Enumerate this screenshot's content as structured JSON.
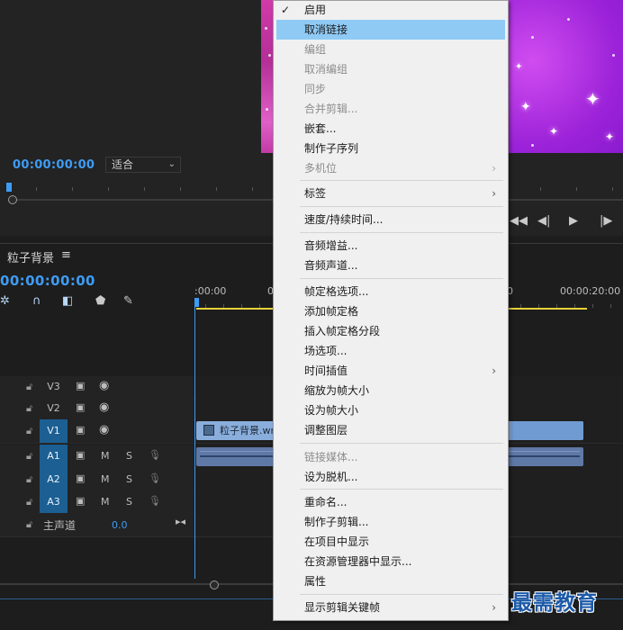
{
  "monitor": {
    "timecode": "00:00:00:00",
    "fit_label": "适合"
  },
  "transport": [
    "◀◀",
    "◀|",
    "▶",
    "|▶"
  ],
  "timeline": {
    "sequence_name": "粒子背景",
    "menu_glyph": "≡",
    "timecode": "00:00:00:00",
    "ruler": {
      "start": ":00:00",
      "zero": "0",
      "mid": "0",
      "end": "00:00:20:00"
    },
    "tracks": {
      "v3": "V3",
      "v2": "V2",
      "v1": "V1",
      "a1": "A1",
      "a2": "A2",
      "a3": "A3",
      "m": "M",
      "s": "S"
    },
    "master": {
      "label": "主声道",
      "value": "0.0"
    },
    "clip_v1_label": "粒子背景.wm"
  },
  "context_menu": {
    "items": [
      {
        "label": "启用",
        "checked": true
      },
      {
        "label": "取消链接",
        "hover": true
      },
      {
        "label": "编组",
        "disabled": true
      },
      {
        "label": "取消编组",
        "disabled": true
      },
      {
        "label": "同步",
        "disabled": true
      },
      {
        "label": "合并剪辑...",
        "disabled": true
      },
      {
        "label": "嵌套..."
      },
      {
        "label": "制作子序列"
      },
      {
        "label": "多机位",
        "disabled": true,
        "submenu": true
      },
      {
        "label": "标签",
        "submenu": true
      },
      {
        "label": "速度/持续时间..."
      },
      {
        "label": "音频增益..."
      },
      {
        "label": "音频声道..."
      },
      {
        "label": "帧定格选项..."
      },
      {
        "label": "添加帧定格"
      },
      {
        "label": "插入帧定格分段"
      },
      {
        "label": "场选项..."
      },
      {
        "label": "时间插值",
        "submenu": true
      },
      {
        "label": "缩放为帧大小"
      },
      {
        "label": "设为帧大小"
      },
      {
        "label": "调整图层"
      },
      {
        "label": "链接媒体...",
        "disabled": true
      },
      {
        "label": "设为脱机..."
      },
      {
        "label": "重命名..."
      },
      {
        "label": "制作子剪辑..."
      },
      {
        "label": "在项目中显示"
      },
      {
        "label": "在资源管理器中显示..."
      },
      {
        "label": "属性"
      },
      {
        "label": "显示剪辑关键帧",
        "submenu": true
      }
    ],
    "check_glyph": "✓",
    "arrow_glyph": "›"
  },
  "watermark": "最需教育",
  "colors": {
    "accent_blue": "#3e9cf5",
    "menu_hover": "#8fcaf5",
    "workarea_yellow": "#e6d23a",
    "clip_video": "#8aaedc",
    "clip_audio": "#5f79a7"
  }
}
